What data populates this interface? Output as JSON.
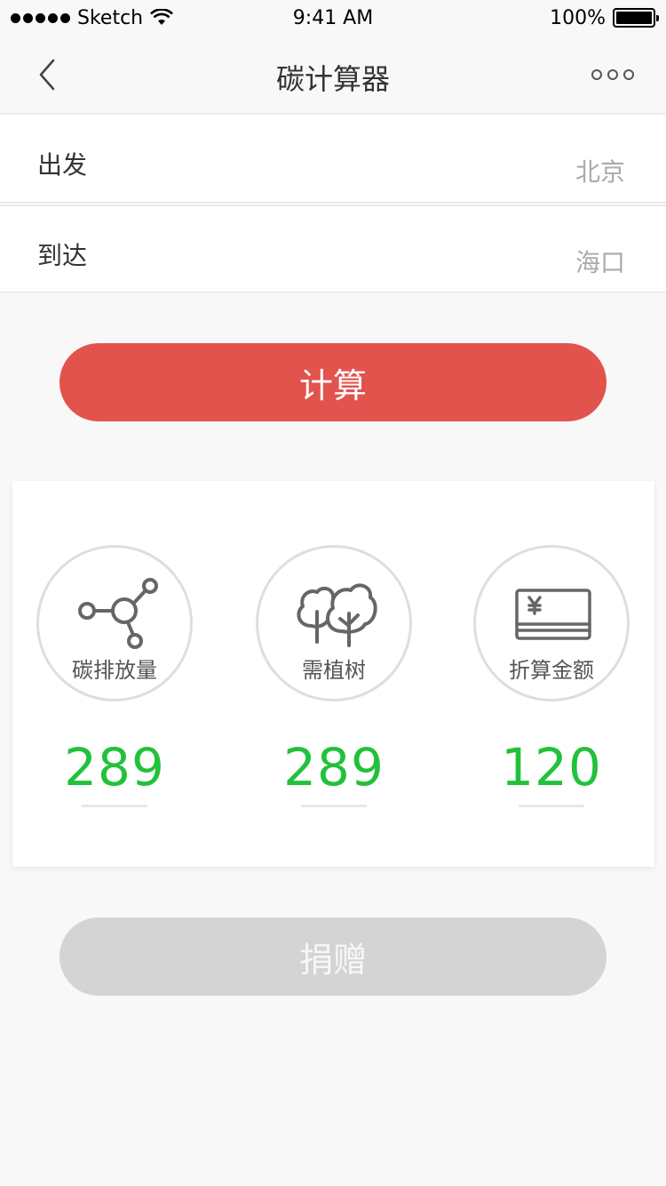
{
  "status_bar": {
    "carrier": "Sketch",
    "time": "9:41 AM",
    "battery": "100%"
  },
  "nav": {
    "title": "碳计算器",
    "back_icon": "chevron-left-icon",
    "more_icon": "more-dots-icon"
  },
  "form": {
    "from_label": "出发",
    "from_value": "北京",
    "to_label": "到达",
    "to_value": "海口"
  },
  "calculate_label": "计算",
  "results": [
    {
      "label": "碳排放量",
      "value": "289",
      "icon": "molecule-icon"
    },
    {
      "label": "需植树",
      "value": "289",
      "icon": "trees-icon"
    },
    {
      "label": "折算金额",
      "value": "120",
      "icon": "yen-card-icon"
    }
  ],
  "donate_label": "捐赠",
  "colors": {
    "accent_red": "#e2534d",
    "value_green": "#22c13a",
    "disabled_gray": "#d4d4d4"
  }
}
